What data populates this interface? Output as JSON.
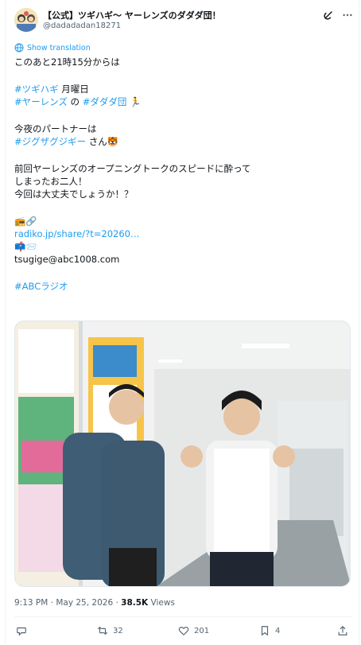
{
  "post": {
    "display_name": "【公式】ツギハギ〜 ヤーレンズのダダダ団！",
    "handle": "@dadadadan18271",
    "show_translation": "Show translation",
    "line1": "このあと21時15分からは",
    "tag_tsugihagi": "#ツギハギ",
    "text_monday": " 月曜日",
    "tag_yarlens": "#ヤーレンズ",
    "text_no": " の ",
    "tag_dadada": "#ダダダ団",
    "emoji_runner": "🏃",
    "line_partner": "今夜のパートナーは",
    "tag_zigzag": "#ジグザグジギー",
    "text_san": " さん",
    "emoji_tiger": "🐯",
    "line_last_time": "前回ヤーレンズのオープニングトークのスピードに酔ってしまったお二人！",
    "line_this_time": "今回は大丈夫でしょうか！？",
    "emoji_radio_link": "📻🔗",
    "radiko_link": "radiko.jp/share/?t=20260…",
    "emoji_mail": "📫📨",
    "email": "tsugige@abc1008.com",
    "tag_abc": "#ABCラジオ"
  },
  "meta": {
    "time": "9:13 PM · May 25, 2026 · ",
    "views_count": "38.5K",
    "views_label": " Views"
  },
  "actions": {
    "retweets": "32",
    "likes": "201",
    "bookmarks": "4"
  },
  "colors": {
    "link": "#1d9bf0",
    "secondary_text": "#536471",
    "primary_text": "#0f1419"
  },
  "icons": [
    "grok-icon",
    "more-icon",
    "translate-icon",
    "reply-icon",
    "retweet-icon",
    "like-icon",
    "bookmark-icon",
    "share-icon"
  ]
}
